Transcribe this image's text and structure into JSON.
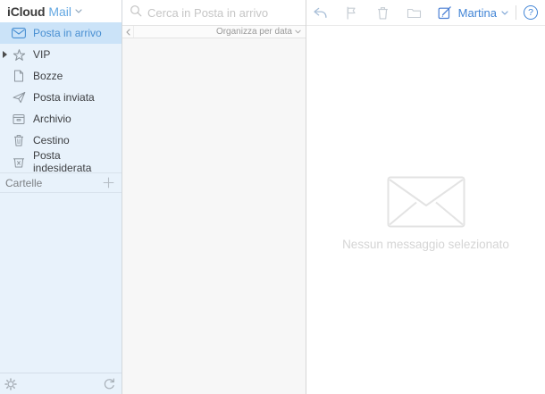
{
  "colors": {
    "accent_blue": "#4a90d2",
    "link_blue": "#64a8e2",
    "toolbar_blue": "#4a7fd4",
    "sidebar_bg": "#e8f2fb",
    "sidebar_selected_bg": "#cbe3f8",
    "list_bg": "#f7f7f7",
    "muted_icon_gray": "#8b949c",
    "disabled_icon_gray": "#c6cdd4",
    "empty_gray": "#e3e3e3"
  },
  "header": {
    "brand": "iCloud",
    "app": "Mail"
  },
  "sidebar": {
    "items": [
      {
        "label": "Posta in arrivo",
        "icon": "inbox-icon",
        "selected": true
      },
      {
        "label": "VIP",
        "icon": "star-icon",
        "expandable": true
      },
      {
        "label": "Bozze",
        "icon": "draft-icon"
      },
      {
        "label": "Posta inviata",
        "icon": "paper-plane-icon"
      },
      {
        "label": "Archivio",
        "icon": "archive-icon"
      },
      {
        "label": "Cestino",
        "icon": "trash-icon"
      },
      {
        "label": "Posta indesiderata",
        "icon": "junk-icon"
      }
    ],
    "folders": {
      "label": "Cartelle",
      "add_icon": "plus-icon"
    },
    "footer_icons": [
      "gear-icon",
      "refresh-icon"
    ]
  },
  "list_pane": {
    "search": {
      "placeholder": "Cerca in Posta in arrivo",
      "icon": "search-icon"
    },
    "sort": {
      "label": "Organizza per data"
    },
    "collapse_icon": "chevron-left-icon"
  },
  "toolbar": {
    "icons": [
      "reply-icon",
      "flag-icon",
      "trash-icon",
      "folder-icon",
      "compose-icon"
    ],
    "user": "Martina",
    "help_label": "?"
  },
  "content": {
    "empty_icon": "envelope-icon",
    "empty_state": "Nessun messaggio selezionato"
  }
}
